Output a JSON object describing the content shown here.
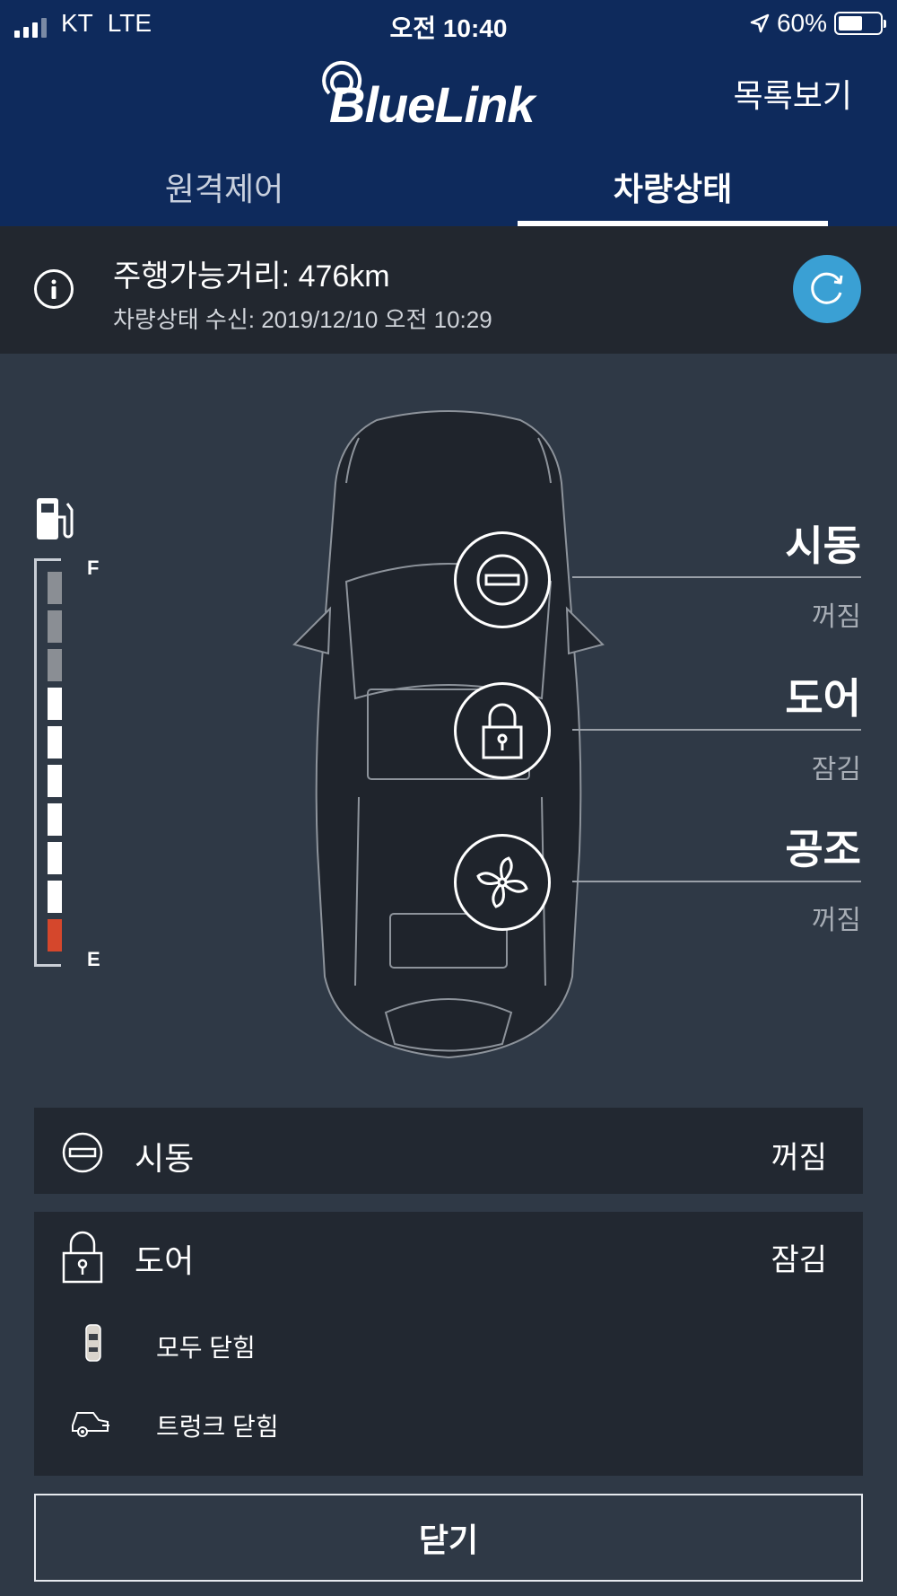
{
  "status_bar": {
    "carrier": "KT",
    "network": "LTE",
    "time": "오전 10:40",
    "battery": "60%"
  },
  "header": {
    "logo_text": "BlueLink",
    "list_view": "목록보기"
  },
  "tabs": [
    {
      "label": "원격제어",
      "active": false
    },
    {
      "label": "차량상태",
      "active": true
    }
  ],
  "info": {
    "range": "주행가능거리: 476km",
    "received": "차량상태 수신: 2019/12/10 오전 10:29"
  },
  "fuel_gauge": {
    "full_label": "F",
    "empty_label": "E",
    "segments_total": 10,
    "segments_white": 6,
    "segments_gray": 3,
    "segments_red": 1,
    "low_color": "#d5472c"
  },
  "status_items": [
    {
      "title": "시동",
      "value": "꺼짐",
      "icon": "engine-off-icon"
    },
    {
      "title": "도어",
      "value": "잠김",
      "icon": "lock-icon"
    },
    {
      "title": "공조",
      "value": "꺼짐",
      "icon": "fan-icon"
    }
  ],
  "cards": {
    "engine": {
      "title": "시동",
      "value": "꺼짐"
    },
    "door": {
      "title": "도어",
      "value": "잠김",
      "details": [
        {
          "label": "모두 닫힘",
          "icon": "car-top-icon"
        },
        {
          "label": "트렁크 닫힘",
          "icon": "trunk-icon"
        }
      ]
    }
  },
  "close_button": "닫기",
  "colors": {
    "header_bg": "#0e2a5c",
    "accent": "#3aa0d4",
    "body_bg": "#2f3946"
  }
}
